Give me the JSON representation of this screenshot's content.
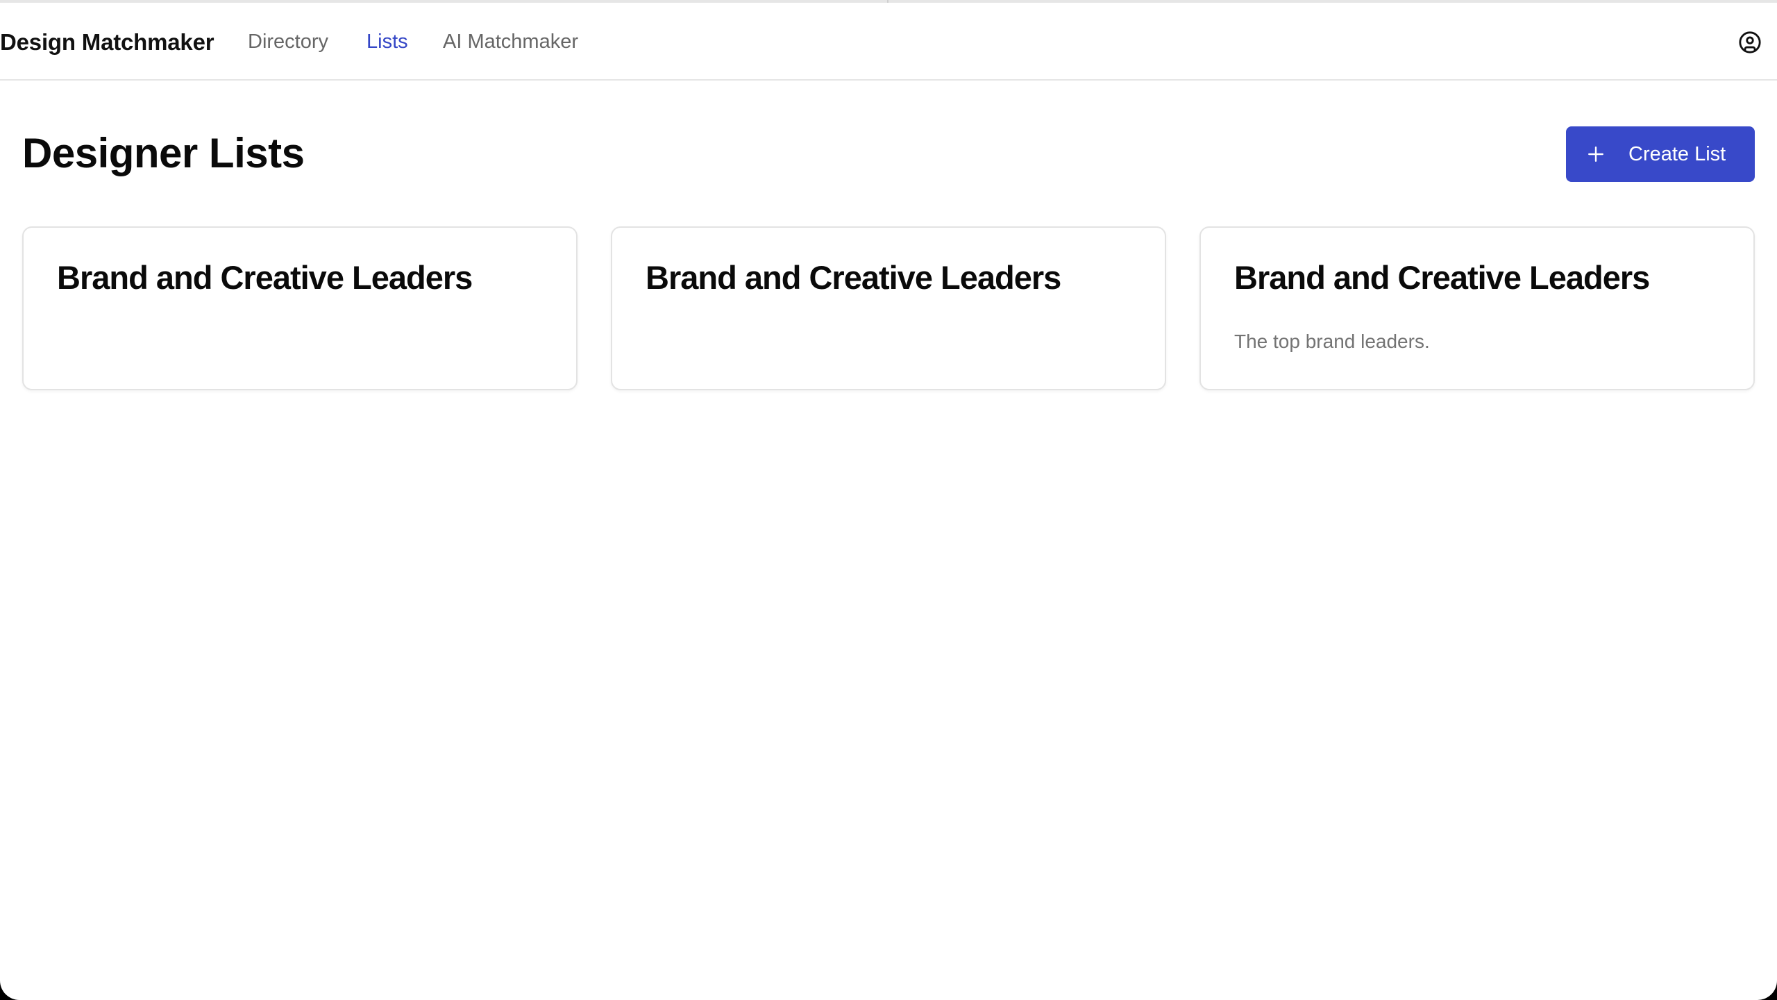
{
  "app": {
    "brand": "Design Matchmaker"
  },
  "nav": {
    "items": [
      {
        "label": "Directory",
        "active": false
      },
      {
        "label": "Lists",
        "active": true
      },
      {
        "label": "AI Matchmaker",
        "active": false
      }
    ],
    "user_icon": "user-circle-icon"
  },
  "page": {
    "title": "Designer Lists",
    "create_button": {
      "label": "Create List",
      "icon": "plus-icon"
    }
  },
  "lists": [
    {
      "title": "Brand and Creative Leaders",
      "description": ""
    },
    {
      "title": "Brand and Creative Leaders",
      "description": ""
    },
    {
      "title": "Brand and Creative Leaders",
      "description": "The top brand leaders."
    }
  ],
  "colors": {
    "accent": "#3849c9",
    "active_link": "#3446c6",
    "muted_text": "#737373",
    "border": "#e3e3e3"
  }
}
